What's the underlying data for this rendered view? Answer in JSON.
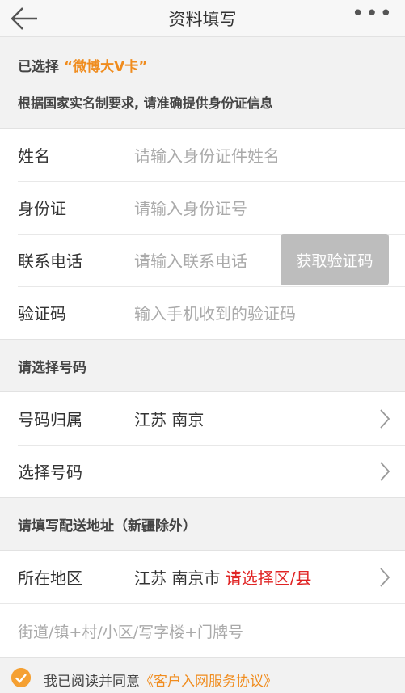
{
  "header": {
    "title": "资料填写",
    "more": "•••"
  },
  "info": {
    "selected_prefix": "已选择",
    "selected_card": "“微博大V卡”",
    "notice": "根据国家实名制要求, 请准确提供身份证信息"
  },
  "form": {
    "name_label": "姓名",
    "name_placeholder": "请输入身份证件姓名",
    "id_label": "身份证",
    "id_placeholder": "请输入身份证号",
    "phone_label": "联系电话",
    "phone_placeholder": "请输入联系电话",
    "get_code_button": "获取验证码",
    "code_label": "验证码",
    "code_placeholder": "输入手机收到的验证码"
  },
  "number_section": {
    "title": "请选择号码",
    "region_label": "号码归属",
    "region_value": "江苏 南京",
    "select_label": "选择号码"
  },
  "address_section": {
    "title": "请填写配送地址（新疆除外）",
    "area_label": "所在地区",
    "area_value": "江苏 南京市 ",
    "area_prompt": "请选择区/县",
    "street_placeholder": "街道/镇+村/小区/写字楼+门牌号"
  },
  "agreement": {
    "text": "我已阅读并同意",
    "link": "《客户入网服务协议》"
  },
  "colors": {
    "accent": "#f08c1e",
    "warning": "#e02424",
    "button_disabled": "#bdbdbd"
  }
}
